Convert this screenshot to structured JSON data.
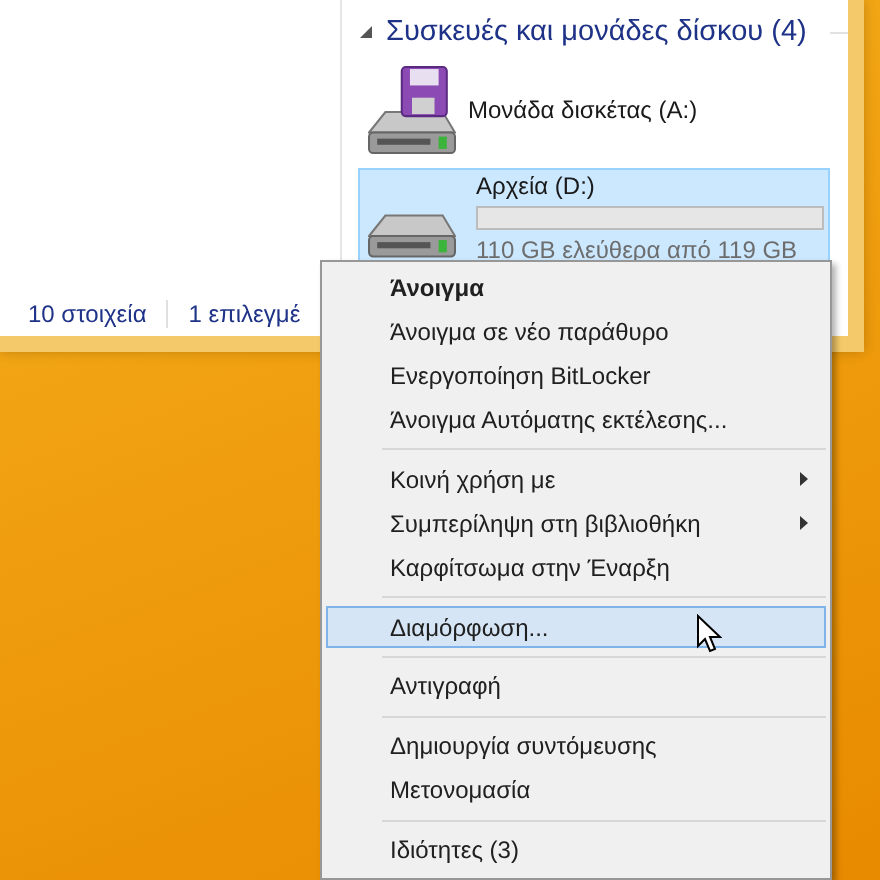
{
  "section": {
    "title": "Συσκευές και μονάδες δίσκου (4)",
    "expanded": true
  },
  "drives": [
    {
      "kind": "floppy",
      "name": "Μονάδα δισκέτας (A:)",
      "selected": false
    },
    {
      "kind": "disk",
      "name": "Αρχεία (D:)",
      "selected": true,
      "level": 0.0,
      "space": "110 GB ελεύθερα από 119 GB"
    }
  ],
  "status_bar": {
    "count": "10 στοιχεία",
    "selection": "1 επιλεγμέ"
  },
  "context_menu": [
    {
      "kind": "item",
      "label": "Άνοιγμα",
      "default": true,
      "submenu": false,
      "selected": false
    },
    {
      "kind": "item",
      "label": "Άνοιγμα σε νέο παράθυρο",
      "default": false,
      "submenu": false,
      "selected": false
    },
    {
      "kind": "item",
      "label": "Ενεργοποίηση BitLocker",
      "default": false,
      "submenu": false,
      "selected": false
    },
    {
      "kind": "item",
      "label": "Άνοιγμα Αυτόματης εκτέλεσης...",
      "default": false,
      "submenu": false,
      "selected": false
    },
    {
      "kind": "separator"
    },
    {
      "kind": "item",
      "label": "Κοινή χρήση με",
      "default": false,
      "submenu": true,
      "selected": false
    },
    {
      "kind": "item",
      "label": "Συμπερίληψη στη βιβλιοθήκη",
      "default": false,
      "submenu": true,
      "selected": false
    },
    {
      "kind": "item",
      "label": "Καρφίτσωμα στην Έναρξη",
      "default": false,
      "submenu": false,
      "selected": false
    },
    {
      "kind": "separator"
    },
    {
      "kind": "item",
      "label": "Διαμόρφωση...",
      "default": false,
      "submenu": false,
      "selected": true
    },
    {
      "kind": "separator"
    },
    {
      "kind": "item",
      "label": "Αντιγραφή",
      "default": false,
      "submenu": false,
      "selected": false
    },
    {
      "kind": "separator"
    },
    {
      "kind": "item",
      "label": "Δημιουργία συντόμευσης",
      "default": false,
      "submenu": false,
      "selected": false
    },
    {
      "kind": "item",
      "label": "Μετονομασία",
      "default": false,
      "submenu": false,
      "selected": false
    },
    {
      "kind": "separator"
    },
    {
      "kind": "item",
      "label": "Ιδιότητες (3)",
      "default": false,
      "submenu": false,
      "selected": false
    }
  ]
}
